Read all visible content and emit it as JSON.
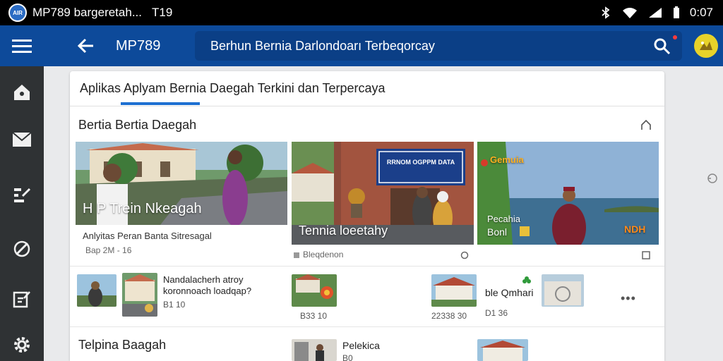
{
  "status_bar": {
    "app_title": "MP789 bargeretah...",
    "time_left": "T19",
    "clock": "0:07"
  },
  "app_bar": {
    "app_name": "MP789",
    "search_text": "Berhun Bernia Darlondoarı Terbeqorcay",
    "avatar_icon": "avatar-icon",
    "brand_color": "#0d4a9a"
  },
  "rail": {
    "items": [
      "home-icon",
      "mail-icon",
      "chart-icon",
      "slash-icon",
      "notes-icon",
      "settings-icon"
    ]
  },
  "tabs": [
    {
      "label": "Aplikas"
    },
    {
      "label": "Aplyam Bernia Daegah Terkini dan Terpercaya"
    }
  ],
  "section1": {
    "title": "Bertia  Bertia Daegah"
  },
  "features": [
    {
      "caption": "H  P Trein Nkeagah",
      "headline": "Anlyitas Peran Banta Sitresagal",
      "meta": "Bap 2M - 16"
    },
    {
      "caption": "Tennia loeetahy",
      "sign_text": "RRNOM OGPPM DATA",
      "meta": "Bleqdenon"
    },
    {
      "caption_top": "Pecahia",
      "caption_bottom": "Bonl",
      "brand_tag": "Gemuia",
      "corner_tag": "NDH"
    }
  ],
  "list_row": [
    {
      "title_line1": "Nandalacherh atroy",
      "title_line2": "koronnoach loadqap?",
      "meta": "B1  10"
    },
    {
      "meta": "B33 10"
    },
    {
      "meta": "22338 30"
    },
    {
      "title": "ble Qmhari",
      "meta": "D1  36"
    }
  ],
  "section2": {
    "title": "Telpina Baagah",
    "item_title": "Pelekica",
    "item_meta": "B0"
  }
}
